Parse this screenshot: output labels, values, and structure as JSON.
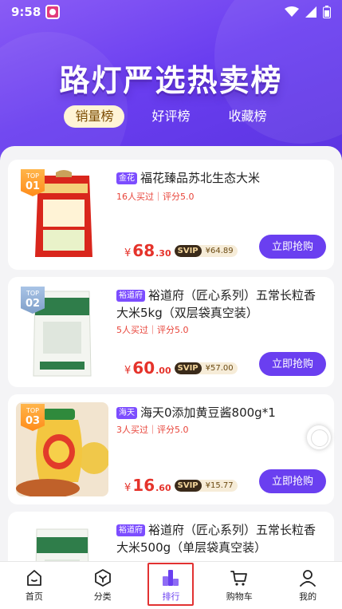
{
  "status": {
    "time": "9:58"
  },
  "hero": {
    "title": "路灯严选热卖榜"
  },
  "tabs": [
    {
      "label": "销量榜",
      "active": true
    },
    {
      "label": "好评榜",
      "active": false
    },
    {
      "label": "收藏榜",
      "active": false
    }
  ],
  "products": [
    {
      "rank_top": "TOP",
      "rank_num": "01",
      "shop_tag": "金花",
      "title": "福花臻品苏北生态大米",
      "meta": "16人买过｜评分5.0",
      "price_symbol": "¥",
      "price_int": "68",
      "price_dec": ".30",
      "svip_label": "SVIP",
      "svip_price": "¥64.89",
      "buy_label": "立即抢购"
    },
    {
      "rank_top": "TOP",
      "rank_num": "02",
      "shop_tag": "裕道府",
      "title": "裕道府（匠心系列）五常长粒香大米5kg（双层袋真空装）",
      "meta": "5人买过｜评分5.0",
      "price_symbol": "¥",
      "price_int": "60",
      "price_dec": ".00",
      "svip_label": "SVIP",
      "svip_price": "¥57.00",
      "buy_label": "立即抢购"
    },
    {
      "rank_top": "TOP",
      "rank_num": "03",
      "shop_tag": "海天",
      "title": "海天0添加黄豆酱800g*1",
      "meta": "3人买过｜评分5.0",
      "price_symbol": "¥",
      "price_int": "16",
      "price_dec": ".60",
      "svip_label": "SVIP",
      "svip_price": "¥15.77",
      "buy_label": "立即抢购"
    },
    {
      "shop_tag": "裕道府",
      "title": "裕道府（匠心系列）五常长粒香大米500g（单层袋真空装）"
    }
  ],
  "tabbar": [
    {
      "label": "首页",
      "icon": "home-icon",
      "active": false
    },
    {
      "label": "分类",
      "icon": "category-icon",
      "active": false
    },
    {
      "label": "排行",
      "icon": "ranking-icon",
      "active": true
    },
    {
      "label": "购物车",
      "icon": "cart-icon",
      "active": false
    },
    {
      "label": "我的",
      "icon": "profile-icon",
      "active": false
    }
  ],
  "colors": {
    "accent": "#6a3ff0",
    "price": "#e5332b",
    "highlight": "#e23232"
  }
}
